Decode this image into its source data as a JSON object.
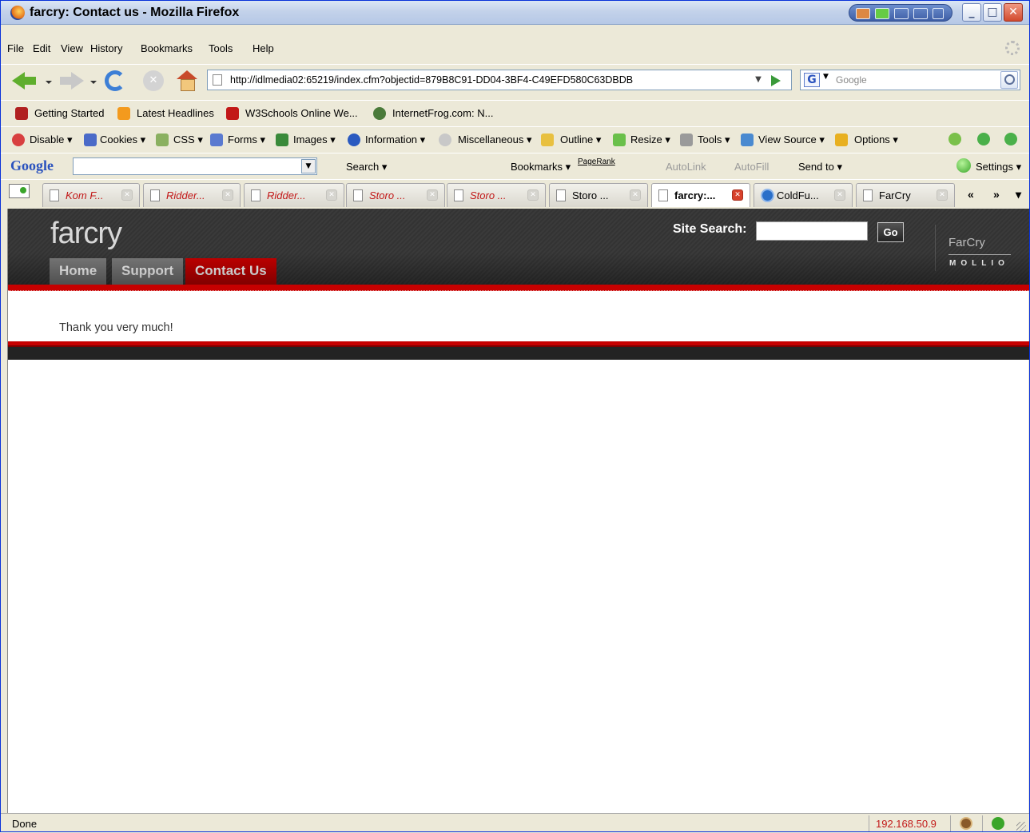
{
  "window": {
    "title": "farcry: Contact us - Mozilla Firefox"
  },
  "menu": [
    "File",
    "Edit",
    "View",
    "History",
    "Bookmarks",
    "Tools",
    "Help"
  ],
  "nav": {
    "url": "http://idlmedia02:65219/index.cfm?objectid=879B8C91-DD04-3BF4-C49EFD580C63DBDB",
    "search_placeholder": "Google"
  },
  "bookmarks": [
    "Getting Started",
    "Latest Headlines",
    "W3Schools Online We...",
    "InternetFrog.com: N..."
  ],
  "webdev": [
    "Disable",
    "Cookies",
    "CSS",
    "Forms",
    "Images",
    "Information",
    "Miscellaneous",
    "Outline",
    "Resize",
    "Tools",
    "View Source",
    "Options"
  ],
  "google_toolbar": {
    "logo": "Google",
    "search": "Search",
    "bookmarks": "Bookmarks",
    "pagerank": "PageRank",
    "autolink": "AutoLink",
    "autofill": "AutoFill",
    "send_to": "Send to",
    "settings": "Settings"
  },
  "tabs": [
    {
      "label": "Kom F..."
    },
    {
      "label": "Ridder..."
    },
    {
      "label": "Ridder..."
    },
    {
      "label": "Storo ..."
    },
    {
      "label": "Storo ..."
    },
    {
      "label": "Storo ..."
    },
    {
      "label": "farcry:..."
    },
    {
      "label": "ColdFu..."
    },
    {
      "label": "FarCry"
    }
  ],
  "tab_scroll": {
    "left": "«",
    "right": "»",
    "list": "▾"
  },
  "site": {
    "logo": "farcry",
    "search_label": "Site Search:",
    "go": "Go",
    "brand_top": "FarCry",
    "brand_bottom": "MOLLIO",
    "nav": [
      "Home",
      "Support",
      "Contact Us"
    ],
    "message": "Thank you very much!"
  },
  "status": {
    "text": "Done",
    "ip": "192.168.50.9"
  },
  "colors": {
    "accent_red": "#c60000",
    "header_dark": "#333333",
    "nav_inactive": "#7a7a7a"
  }
}
